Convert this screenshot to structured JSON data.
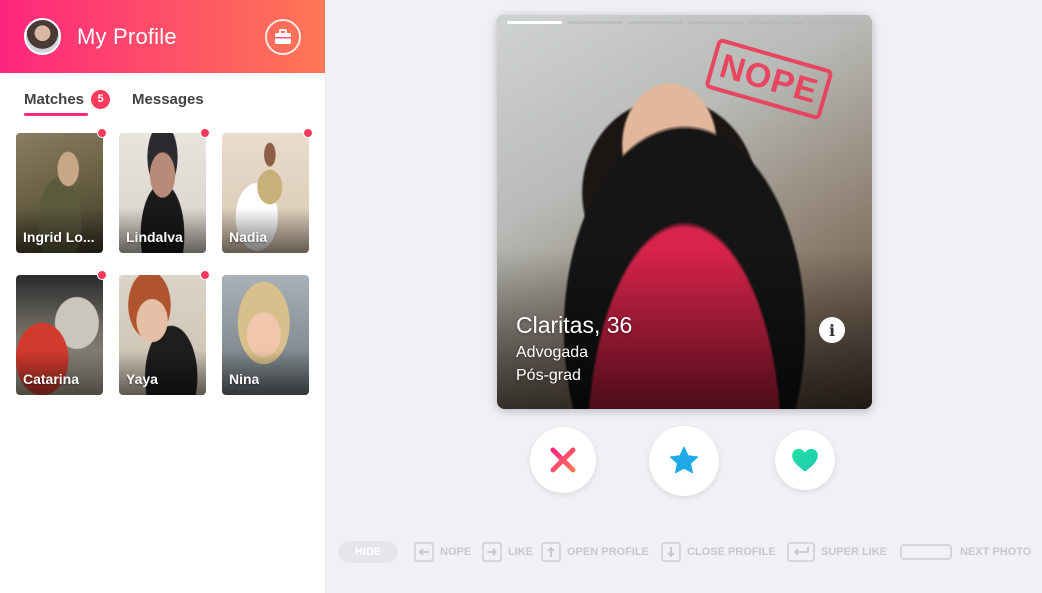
{
  "header": {
    "title": "My Profile",
    "avatar": "user-avatar",
    "right_icon": "briefcase-icon"
  },
  "tabs": [
    {
      "label": "Matches",
      "count": "5",
      "active": true
    },
    {
      "label": "Messages",
      "active": false
    }
  ],
  "matches": [
    {
      "name": "Ingrid Lo...",
      "new": true
    },
    {
      "name": "Lindalva",
      "new": true
    },
    {
      "name": "Nadia",
      "new": true
    },
    {
      "name": "Catarina",
      "new": true
    },
    {
      "name": "Yaya",
      "new": true
    },
    {
      "name": "Nina",
      "new": false
    }
  ],
  "card": {
    "name_age": "Claritas, 36",
    "line1": "Advogada",
    "line2": "Pós-grad",
    "stamp": "NOPE",
    "photo_count": 6,
    "current_photo": 1,
    "info_icon": "info-icon"
  },
  "actions": [
    {
      "name": "nope",
      "icon": "x-icon",
      "color": "#fd5068"
    },
    {
      "name": "super-like",
      "icon": "star-icon",
      "color": "#1fa9e7"
    },
    {
      "name": "like",
      "icon": "heart-icon",
      "color": "#1ee5a3"
    }
  ],
  "shortcuts": {
    "hide": "HIDE",
    "nope": "NOPE",
    "like": "LIKE",
    "open_profile": "OPEN PROFILE",
    "close_profile": "CLOSE PROFILE",
    "super_like": "SUPER LIKE",
    "next_photo": "NEXT PHOTO"
  },
  "colors": {
    "brand_start": "#fd267d",
    "brand_end": "#ff7854",
    "badge": "#fd3a5b"
  }
}
